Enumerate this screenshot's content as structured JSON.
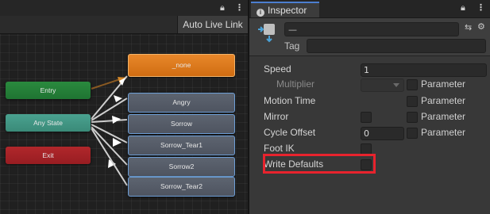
{
  "graph": {
    "auto_live_link": "Auto Live Link",
    "nodes": {
      "none": "_none",
      "entry": "Entry",
      "any_state": "Any State",
      "exit": "Exit",
      "angry": "Angry",
      "sorrow": "Sorrow",
      "sorrow_tear1": "Sorrow_Tear1",
      "sorrow2": "Sorrow2",
      "sorrow_tear2": "Sorrow_Tear2"
    },
    "icons": [
      "lock-icon",
      "more-icon"
    ]
  },
  "inspector": {
    "tab_label": "Inspector",
    "name_value": "—",
    "tag_label": "Tag",
    "fields": {
      "speed_label": "Speed",
      "speed_value": "1",
      "multiplier_label": "Multiplier",
      "motion_time_label": "Motion Time",
      "mirror_label": "Mirror",
      "cycle_offset_label": "Cycle Offset",
      "cycle_offset_value": "0",
      "foot_ik_label": "Foot IK",
      "write_defaults_label": "Write Defaults",
      "parameter_label": "Parameter"
    },
    "colors": {
      "highlight": "#e8232d",
      "tab_accent": "#4c7fd1",
      "default_state": "#e07d1e"
    }
  }
}
